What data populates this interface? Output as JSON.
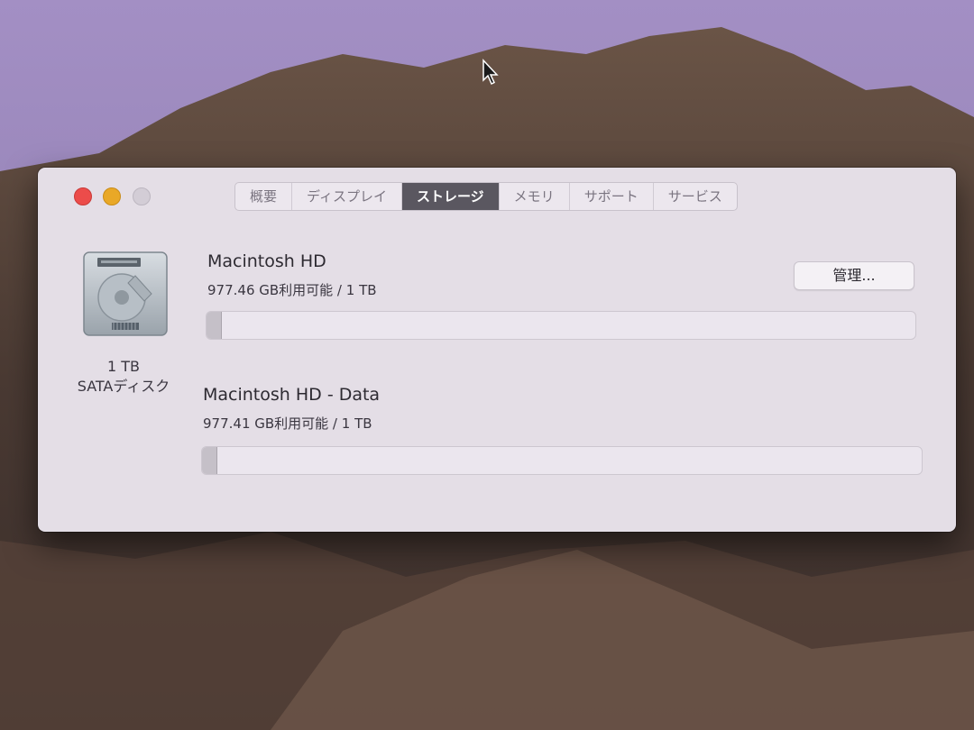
{
  "window": {
    "tabs": [
      {
        "label": "概要"
      },
      {
        "label": "ディスプレイ"
      },
      {
        "label": "ストレージ",
        "active": true
      },
      {
        "label": "メモリ"
      },
      {
        "label": "サポート"
      },
      {
        "label": "サービス"
      }
    ],
    "disk": {
      "capacity": "1 TB",
      "type": "SATAディスク"
    },
    "volumes": [
      {
        "name": "Macintosh HD",
        "usage": "977.46 GB利用可能 / 1 TB",
        "used_fraction": 0.02
      },
      {
        "name": "Macintosh HD - Data",
        "usage": "977.41 GB利用可能 / 1 TB",
        "used_fraction": 0.02
      }
    ],
    "manage_button": "管理..."
  },
  "colors": {
    "close": "#ec4c4a",
    "minimize": "#e9a827",
    "zoom_inactive": "#d3cdd6",
    "active_tab": "#5a5760"
  }
}
